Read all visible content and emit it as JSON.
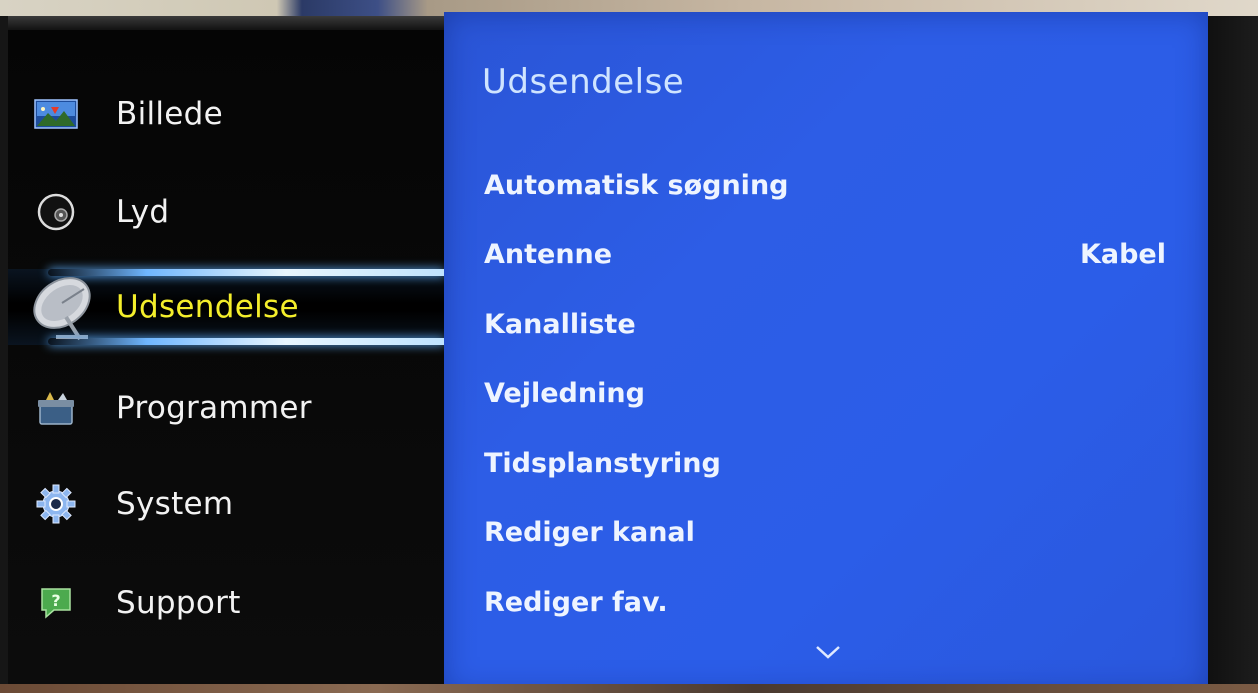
{
  "left_menu": {
    "items": [
      {
        "label": "Billede",
        "icon": "picture-icon"
      },
      {
        "label": "Lyd",
        "icon": "sound-icon"
      },
      {
        "label": "Udsendelse",
        "icon": "satellite-dish-icon",
        "selected": true
      },
      {
        "label": "Programmer",
        "icon": "applications-icon"
      },
      {
        "label": "System",
        "icon": "gear-icon"
      },
      {
        "label": "Support",
        "icon": "help-icon"
      }
    ]
  },
  "sub_panel": {
    "title": "Udsendelse",
    "items": [
      {
        "label": "Automatisk søgning"
      },
      {
        "label": "Antenne",
        "value": "Kabel"
      },
      {
        "label": "Kanalliste"
      },
      {
        "label": "Vejledning"
      },
      {
        "label": "Tidsplanstyring"
      },
      {
        "label": "Rediger kanal"
      },
      {
        "label": "Rediger fav."
      }
    ],
    "scroll_icon": "chevron-down-icon"
  },
  "colors": {
    "panel_blue": "#2b5de8",
    "selected_text": "#f4ee2b",
    "highlight_glow": "#6fb6ff"
  }
}
